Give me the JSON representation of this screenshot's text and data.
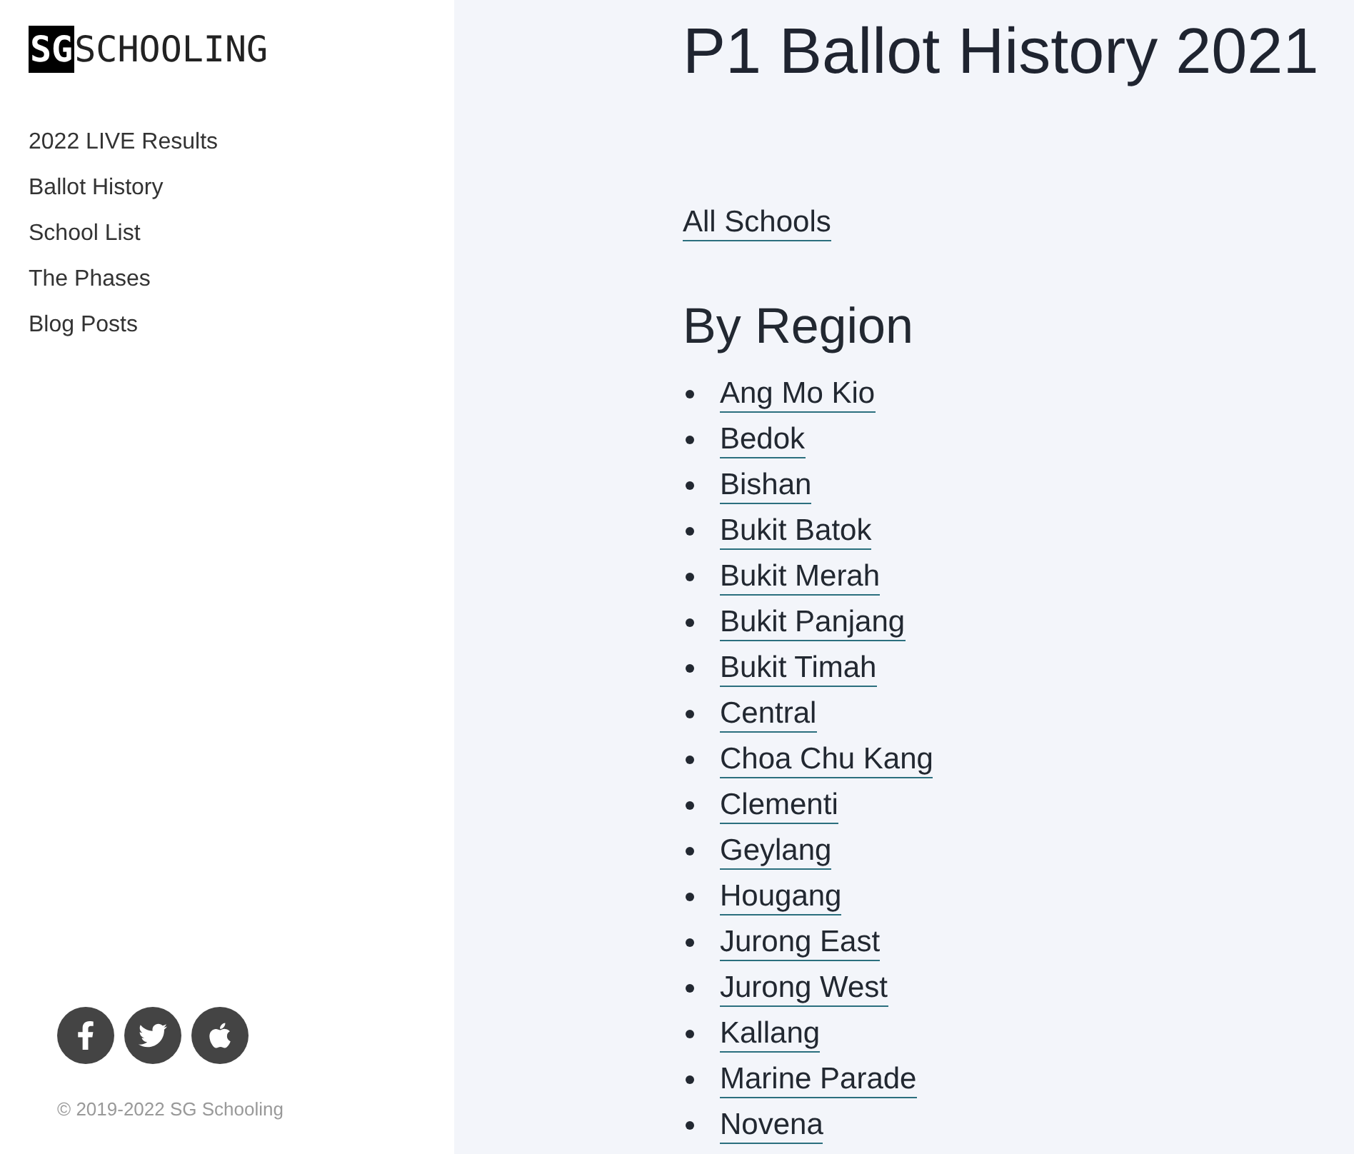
{
  "logo": {
    "boxed": "SG",
    "text": "SCHOOLING"
  },
  "nav": [
    "2022 LIVE Results",
    "Ballot History",
    "School List",
    "The Phases",
    "Blog Posts"
  ],
  "social": [
    {
      "kind": "facebook"
    },
    {
      "kind": "twitter"
    },
    {
      "kind": "apple"
    }
  ],
  "copyright": "© 2019-2022 SG Schooling",
  "title": "P1 Ballot History 2021",
  "all_link": "All Schools",
  "region_heading": "By Region",
  "regions": [
    "Ang Mo Kio",
    "Bedok",
    "Bishan",
    "Bukit Batok",
    "Bukit Merah",
    "Bukit Panjang",
    "Bukit Timah",
    "Central",
    "Choa Chu Kang",
    "Clementi",
    "Geylang",
    "Hougang",
    "Jurong East",
    "Jurong West",
    "Kallang",
    "Marine Parade",
    "Novena"
  ]
}
